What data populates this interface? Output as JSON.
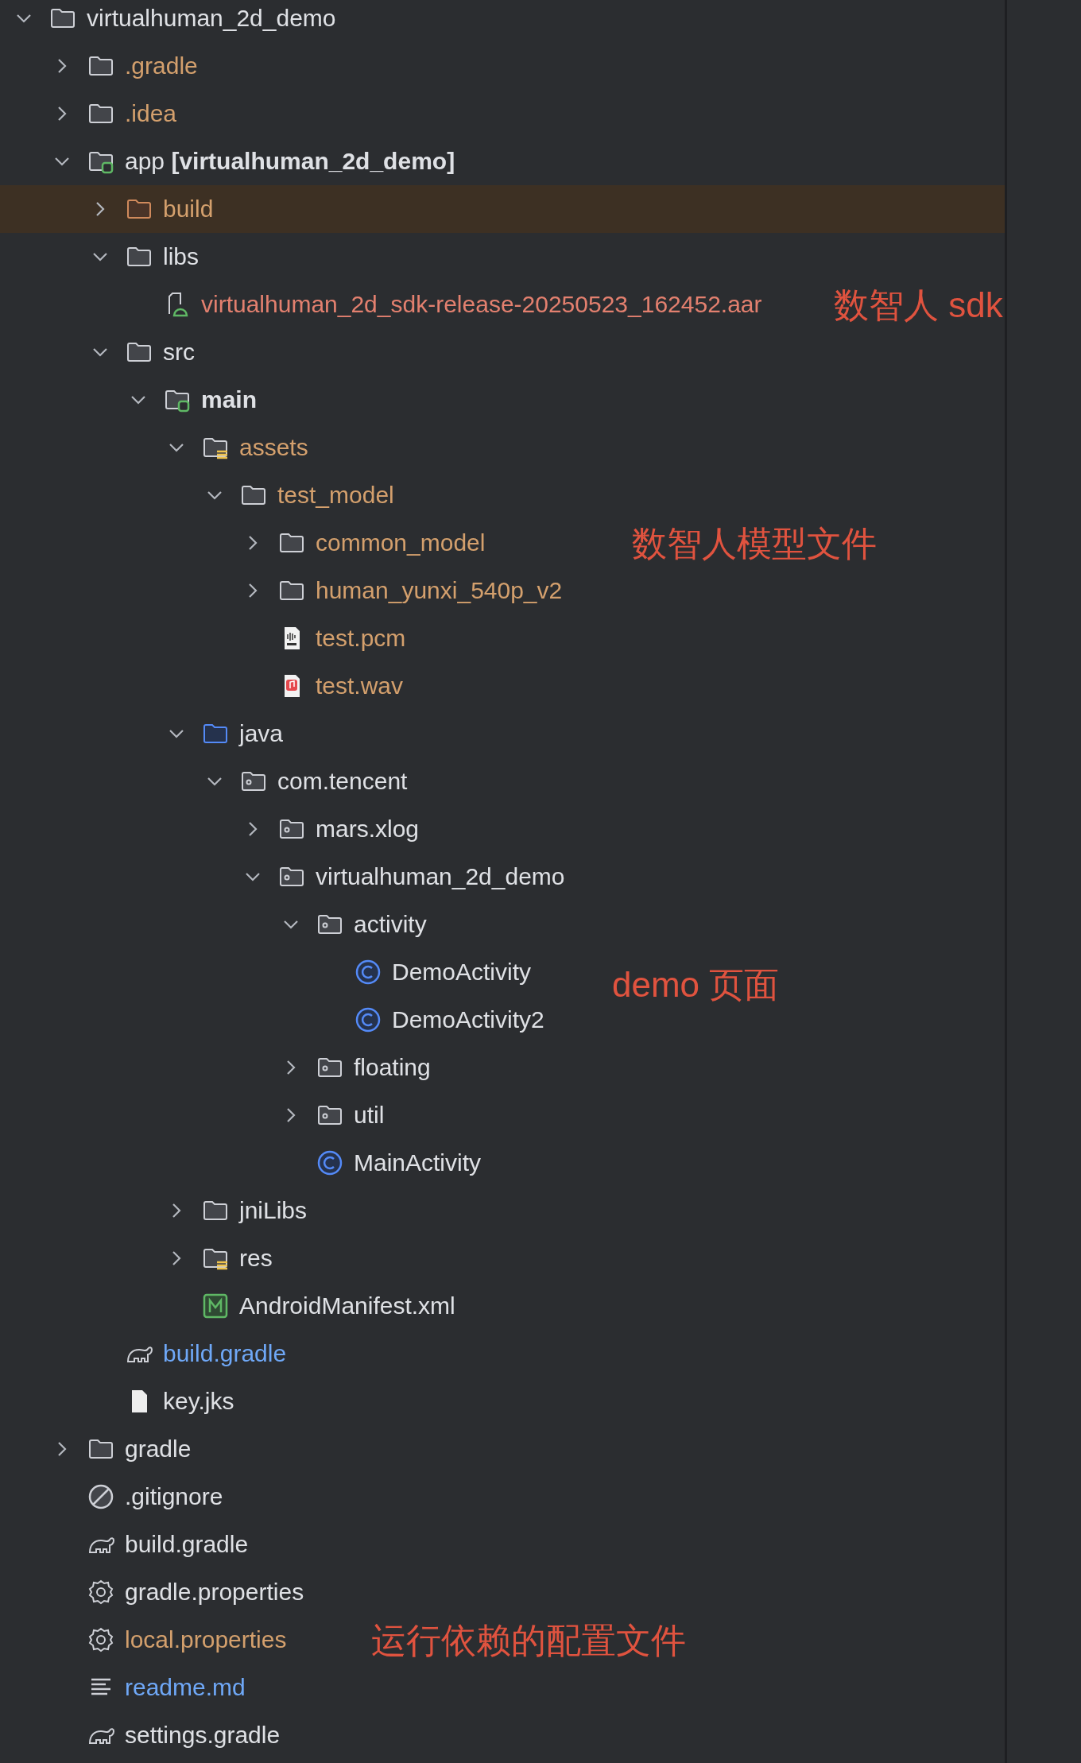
{
  "tree": [
    {
      "name": "virtualhuman_2d_demo",
      "kind": "folder",
      "color": "#dfe1e5",
      "bold": false,
      "expanded": true,
      "children": [
        {
          "name": ".gradle",
          "kind": "folder",
          "color": "#d4a06d",
          "bold": false,
          "expanded": false
        },
        {
          "name": ".idea",
          "kind": "folder",
          "color": "#d4a06d",
          "bold": false,
          "expanded": false
        },
        {
          "name": "app **[virtualhuman_2d_demo]**",
          "kind": "module",
          "color": "#dfe1e5",
          "bold": false,
          "expanded": true,
          "children": [
            {
              "name": "build",
              "kind": "excluded",
              "color": "#d4a06d",
              "bold": false,
              "expanded": false
            },
            {
              "name": "libs",
              "kind": "folder",
              "color": "#dfe1e5",
              "bold": false,
              "expanded": true,
              "children": [
                {
                  "name": "virtualhuman_2d_sdk-release-20250523_162452.aar",
                  "kind": "aar",
                  "color": "#e3806f",
                  "bold": false,
                  "note": "数智人 sdk"
                }
              ]
            },
            {
              "name": "src",
              "kind": "folder",
              "color": "#dfe1e5",
              "bold": false,
              "expanded": true,
              "children": [
                {
                  "name": "main",
                  "kind": "module",
                  "color": "#dfe1e5",
                  "bold": true,
                  "expanded": true,
                  "children": [
                    {
                      "name": "assets",
                      "kind": "resources",
                      "color": "#d4a06d",
                      "bold": false,
                      "expanded": true,
                      "children": [
                        {
                          "name": "test_model",
                          "kind": "folder",
                          "color": "#d4a06d",
                          "bold": false,
                          "expanded": true,
                          "children": [
                            {
                              "name": "common_model",
                              "kind": "folder",
                              "color": "#d4a06d",
                              "bold": false,
                              "expanded": false,
                              "note": "数智人模型文件"
                            },
                            {
                              "name": "human_yunxi_540p_v2",
                              "kind": "folder",
                              "color": "#d4a06d",
                              "bold": false,
                              "expanded": false
                            },
                            {
                              "name": "test.pcm",
                              "kind": "pcm",
                              "color": "#d4a06d",
                              "bold": false
                            },
                            {
                              "name": "test.wav",
                              "kind": "wav",
                              "color": "#d4a06d",
                              "bold": false
                            }
                          ]
                        }
                      ]
                    },
                    {
                      "name": "java",
                      "kind": "source",
                      "color": "#dfe1e5",
                      "bold": false,
                      "expanded": true,
                      "children": [
                        {
                          "name": "com.tencent",
                          "kind": "package",
                          "color": "#dfe1e5",
                          "bold": false,
                          "expanded": true,
                          "children": [
                            {
                              "name": "mars.xlog",
                              "kind": "package",
                              "color": "#dfe1e5",
                              "bold": false,
                              "expanded": false
                            },
                            {
                              "name": "virtualhuman_2d_demo",
                              "kind": "package",
                              "color": "#dfe1e5",
                              "bold": false,
                              "expanded": true,
                              "children": [
                                {
                                  "name": "activity",
                                  "kind": "package",
                                  "color": "#dfe1e5",
                                  "bold": false,
                                  "expanded": true,
                                  "children": [
                                    {
                                      "name": "DemoActivity",
                                      "kind": "class",
                                      "color": "#dfe1e5",
                                      "bold": false,
                                      "note": "demo 页面"
                                    },
                                    {
                                      "name": "DemoActivity2",
                                      "kind": "class",
                                      "color": "#dfe1e5",
                                      "bold": false
                                    }
                                  ]
                                },
                                {
                                  "name": "floating",
                                  "kind": "package",
                                  "color": "#dfe1e5",
                                  "bold": false,
                                  "expanded": false
                                },
                                {
                                  "name": "util",
                                  "kind": "package",
                                  "color": "#dfe1e5",
                                  "bold": false,
                                  "expanded": false
                                },
                                {
                                  "name": "MainActivity",
                                  "kind": "class",
                                  "color": "#dfe1e5",
                                  "bold": false
                                }
                              ]
                            }
                          ]
                        }
                      ]
                    },
                    {
                      "name": "jniLibs",
                      "kind": "folder",
                      "color": "#dfe1e5",
                      "bold": false,
                      "expanded": false
                    },
                    {
                      "name": "res",
                      "kind": "resources",
                      "color": "#dfe1e5",
                      "bold": false,
                      "expanded": false
                    },
                    {
                      "name": "AndroidManifest.xml",
                      "kind": "manifest",
                      "color": "#dfe1e5",
                      "bold": false
                    }
                  ]
                }
              ]
            },
            {
              "name": "build.gradle",
              "kind": "gradle",
              "color": "#6fa8f7",
              "bold": false
            },
            {
              "name": "key.jks",
              "kind": "file",
              "color": "#dfe1e5",
              "bold": false
            }
          ]
        },
        {
          "name": "gradle",
          "kind": "folder",
          "color": "#dfe1e5",
          "bold": false,
          "expanded": false
        },
        {
          "name": ".gitignore",
          "kind": "ignore",
          "color": "#dfe1e5",
          "bold": false
        },
        {
          "name": "build.gradle",
          "kind": "gradle",
          "color": "#dfe1e5",
          "bold": false
        },
        {
          "name": "gradle.properties",
          "kind": "properties",
          "color": "#dfe1e5",
          "bold": false
        },
        {
          "name": "local.properties",
          "kind": "properties",
          "color": "#d4a06d",
          "bold": false,
          "note": "运行依赖的配置文件"
        },
        {
          "name": "readme.md",
          "kind": "text",
          "color": "#6fa8f7",
          "bold": false
        },
        {
          "name": "settings.gradle",
          "kind": "gradle",
          "color": "#dfe1e5",
          "bold": false
        }
      ]
    }
  ]
}
